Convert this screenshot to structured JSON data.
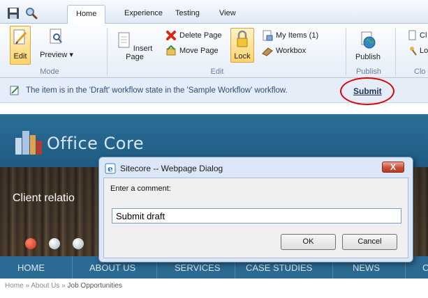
{
  "ribbon": {
    "tabs": [
      "Home",
      "Experience",
      "Testing",
      "View"
    ],
    "groups": {
      "mode": {
        "label": "Mode",
        "edit": "Edit",
        "preview": "Preview ▾"
      },
      "edit": {
        "label": "Edit",
        "insert_page": "Insert Page",
        "delete_page": "Delete Page",
        "move_page": "Move Page",
        "lock": "Lock",
        "my_items": "My Items (1)",
        "workbox": "Workbox"
      },
      "publish": {
        "label": "Publish",
        "publish": "Publish"
      },
      "close": {
        "label": "Clo",
        "item1": "Cl",
        "item2": "Lo"
      }
    }
  },
  "notification": {
    "text": "The item is in the 'Draft' workflow state in the 'Sample Workflow' workflow.",
    "action": "Submit"
  },
  "site": {
    "logo": "Office Core",
    "banner_text": "Client relatio",
    "nav": [
      "HOME",
      "ABOUT US",
      "SERVICES",
      "CASE STUDIES",
      "NEWS",
      "C"
    ],
    "breadcrumb": {
      "items": [
        "Home",
        "About Us"
      ],
      "separator": "»",
      "current": "Job Opportunities"
    }
  },
  "dialog": {
    "title": "Sitecore -- Webpage Dialog",
    "close": "X",
    "prompt": "Enter a comment:",
    "comment_value": "Submit draft",
    "ok": "OK",
    "cancel": "Cancel"
  },
  "colors": {
    "highlight_circle": "#e00000",
    "site_blue": "#1f5880",
    "notify_bg": "#e4edf8"
  }
}
